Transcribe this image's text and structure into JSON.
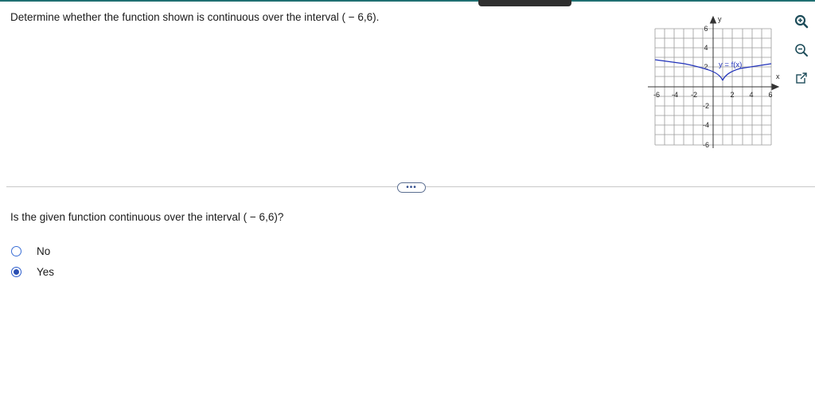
{
  "question": {
    "text": "Determine whether the function shown is continuous over the interval ( − 6,6)."
  },
  "graph": {
    "y_axis_label": "y",
    "x_axis_label": "x",
    "function_label": "y = f(x)",
    "x_ticks": [
      "-6",
      "-4",
      "-2",
      "2",
      "4",
      "6"
    ],
    "y_ticks": [
      "6",
      "4",
      "2",
      "-2",
      "-4",
      "-6"
    ],
    "curve_color": "#2233bb"
  },
  "tools": {
    "zoom_in_icon": "zoom-in-icon",
    "zoom_out_icon": "zoom-out-icon",
    "popout_icon": "external-link-icon"
  },
  "more_button": {
    "label": "•••"
  },
  "sub_question": {
    "text": "Is the given function continuous over the interval ( − 6,6)?"
  },
  "options": [
    {
      "label": "No",
      "selected": false
    },
    {
      "label": "Yes",
      "selected": true
    }
  ],
  "colors": {
    "accent": "#1f6f72",
    "radio": "#2b5ccc"
  }
}
